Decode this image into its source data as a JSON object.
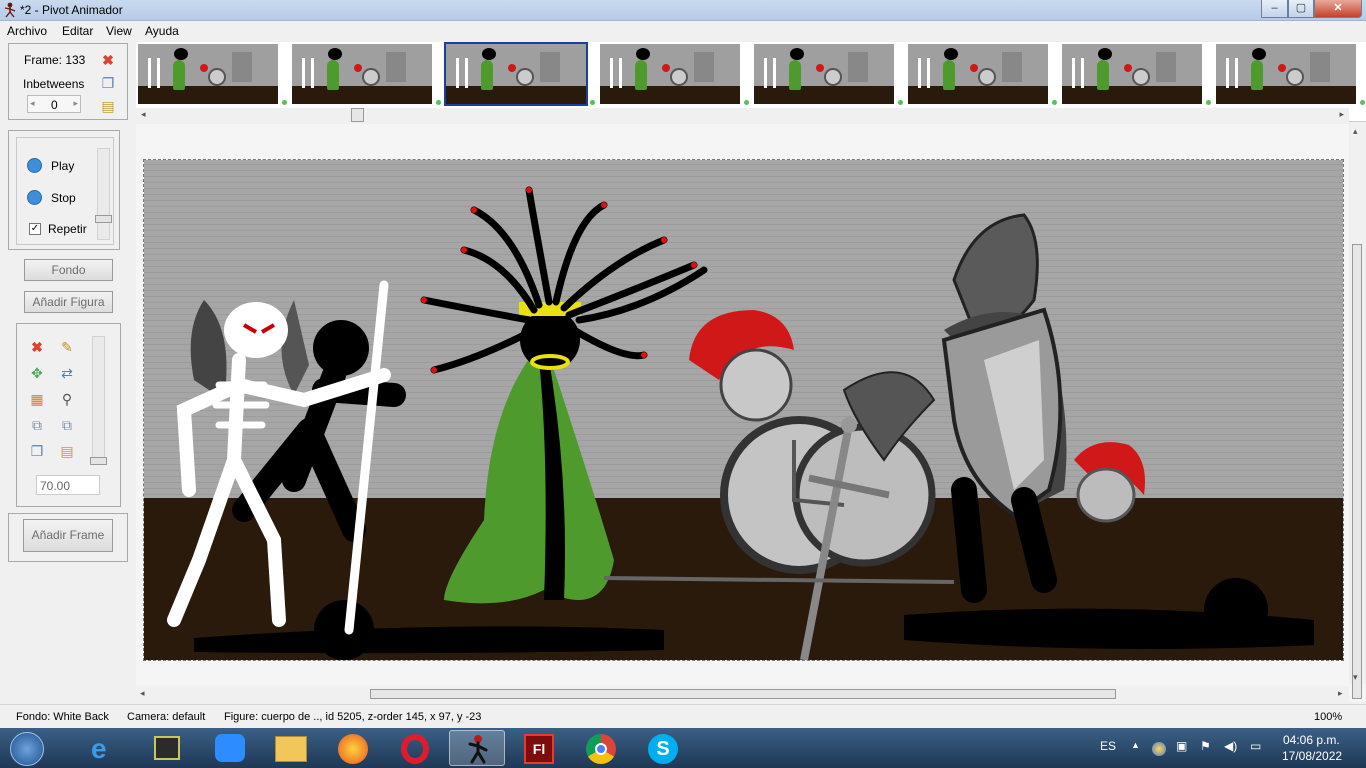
{
  "window": {
    "title": "*2 - Pivot Animador",
    "buttons": [
      "–",
      "▢",
      "✕"
    ]
  },
  "menu": [
    "Archivo",
    "Editar",
    "View",
    "Ayuda"
  ],
  "frame_panel": {
    "frame_label": "Frame: 133",
    "inbetweens_label": "Inbetweens",
    "inbetweens_value": "0"
  },
  "playback": {
    "play": "Play",
    "stop": "Stop",
    "repeat": "Repetir",
    "repeat_checked": true
  },
  "buttons": {
    "fondo": "Fondo",
    "add_figure": "Añadir Figura",
    "add_frame": "Añadir Frame"
  },
  "figure_panel": {
    "scale_value": "70.00"
  },
  "status": {
    "fondo": "Fondo: White Back",
    "camera": "Camera: default",
    "figure": "Figure: cuerpo de ..,  id 5205,  z-order 145,  x 97, y -23",
    "zoom": "100%"
  },
  "taskbar": {
    "lang": "ES",
    "time": "04:06 p.m.",
    "date": "17/08/2022",
    "apps": [
      "start-orb",
      "internet-explorer",
      "terminal",
      "zoom",
      "file-explorer",
      "firefox",
      "opera",
      "pivot-animator",
      "flash",
      "chrome",
      "skype"
    ]
  },
  "colors": {
    "stage_sky": "#a3a3a3",
    "stage_ground": "#2a1a0c",
    "selection": "#1e3e9c"
  }
}
